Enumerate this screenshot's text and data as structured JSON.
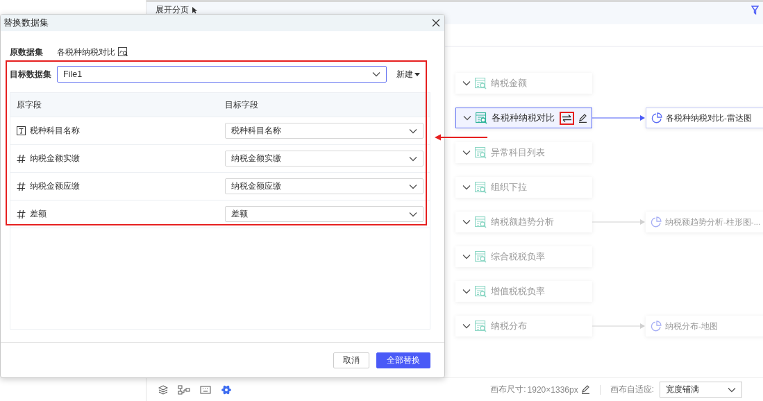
{
  "app": {
    "header_text": "展开分页"
  },
  "canvas": {
    "nodes": [
      {
        "label": "纳税金额",
        "selected": false
      },
      {
        "label": "各税种纳税对比",
        "selected": true,
        "output": "各税种纳税对比-雷达图"
      },
      {
        "label": "异常科目列表",
        "selected": false
      },
      {
        "label": "组织下拉",
        "selected": false
      },
      {
        "label": "纳税额趋势分析",
        "selected": false,
        "output": "纳税额趋势分析-柱形图-..."
      },
      {
        "label": "综合税税负率",
        "selected": false
      },
      {
        "label": "增值税税负率",
        "selected": false
      },
      {
        "label": "纳税分布",
        "selected": false,
        "output": "纳税分布-地图"
      }
    ]
  },
  "status_bar": {
    "canvas_size_label": "画布尺寸:",
    "canvas_size": "1920×1336px",
    "fit_label": "画布自适应:",
    "fit_value": "宽度铺满"
  },
  "dialog": {
    "title": "替换数据集",
    "source_label": "原数据集",
    "source_value": "各税种纳税对比",
    "target_label": "目标数据集",
    "target_value": "File1",
    "new_button": "新建",
    "columns": [
      "原字段",
      "目标字段"
    ],
    "rows": [
      {
        "kind": "text",
        "field": "税种科目名称",
        "target": "税种科目名称"
      },
      {
        "kind": "number",
        "field": "纳税金额实缴",
        "target": "纳税金额实缴"
      },
      {
        "kind": "number",
        "field": "纳税金额应缴",
        "target": "纳税金额应缴"
      },
      {
        "kind": "number",
        "field": "差额",
        "target": "差额"
      }
    ],
    "cancel_button": "取消",
    "confirm_button": "全部替换"
  }
}
